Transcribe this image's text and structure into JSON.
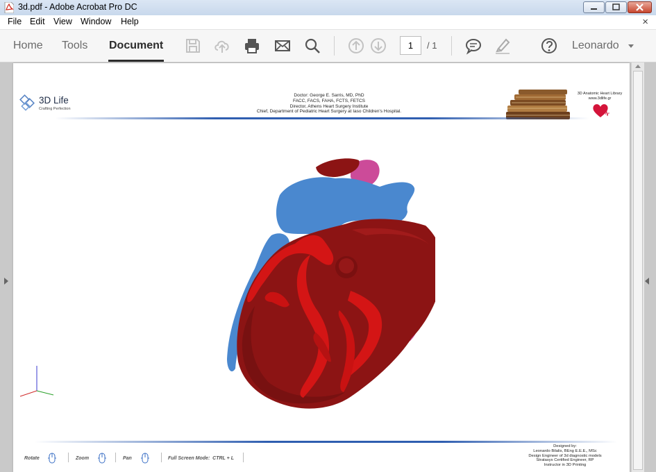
{
  "window": {
    "title": "3d.pdf - Adobe Acrobat Pro DC",
    "app_icon": "acrobat-pdf-icon",
    "controls": [
      "minimize",
      "maximize",
      "close"
    ]
  },
  "menu": {
    "items": [
      "File",
      "Edit",
      "View",
      "Window",
      "Help"
    ],
    "close_glyph": "×"
  },
  "toolbar": {
    "tabs": [
      {
        "label": "Home"
      },
      {
        "label": "Tools"
      },
      {
        "label": "Document",
        "active": true
      }
    ],
    "icons": [
      "save-icon",
      "cloud-upload-icon",
      "print-icon",
      "email-icon",
      "search-icon",
      "previous-page-icon",
      "next-page-icon",
      "comment-icon",
      "highlight-pen-icon",
      "help-icon"
    ],
    "current_page": "1",
    "total_pages": "/ 1",
    "user": "Leonardo"
  },
  "pdf_header": {
    "logo_name": "3D Life",
    "logo_tagline": "Crafting Perfection",
    "center_lines": [
      "Doctor: George E. Sarris, MD, PhD",
      "FACC, FACS, FAHA, FCTS, FETCS",
      "Director, Athens Heart Surgery Institute",
      "Chief, Department of Pediatric Heart Surgery at Iaso Children's Hospital."
    ],
    "library_title": "3D Anatomic Heart Library",
    "library_url": "www.3dlife.gr"
  },
  "pdf_footer": {
    "controls": [
      {
        "label": "Rotate"
      },
      {
        "label": "Zoom"
      },
      {
        "label": "Pan"
      }
    ],
    "fullscreen": "Full Screen Mode:  CTRL + L",
    "designer_lines": [
      "Designed by:",
      "Leonardo Bilalis, BEng E.E.E., MSc",
      "Design Engineer of 3d diagnostic models",
      "Stratasys Certified Engineer, RP",
      "Instructor in 3D Printing"
    ]
  },
  "colors": {
    "accent_blue": "#2f5eb0",
    "heart_dark_red": "#8c1414",
    "artery_red": "#d41515",
    "vessel_blue": "#4a88cf",
    "vessel_pink": "#cc4b99"
  }
}
